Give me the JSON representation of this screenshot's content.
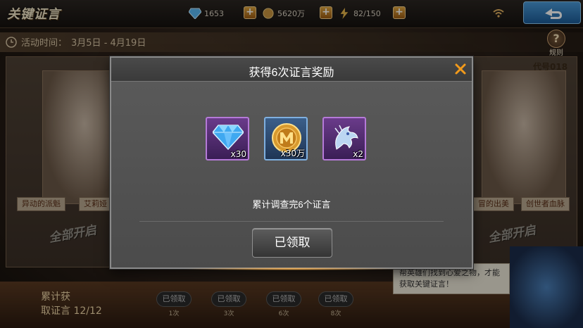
{
  "game": {
    "title": "关键证言"
  },
  "resources": {
    "diamonds": "1653",
    "coins": "5620万",
    "energy": "82/150"
  },
  "activity": {
    "label": "活动时间：",
    "period": "3月5日 - 4月19日"
  },
  "rules": {
    "label": "规则",
    "icon": "question-icon"
  },
  "codename": "代号018",
  "heroes": {
    "name_tags": [
      "异动的派魁",
      "艾莉娅",
      "冒的出美",
      "创世者血脉"
    ],
    "stamp_text": "全部开启"
  },
  "modal": {
    "title": "获得6次证言奖励",
    "rewards": [
      {
        "icon": "diamond-icon",
        "quantity": "x30"
      },
      {
        "icon": "gold-coin-icon",
        "quantity": "x30万"
      },
      {
        "icon": "ice-dragon-icon",
        "quantity": "x2"
      }
    ],
    "description": "累计调查完6个证言",
    "claimed_button": "已领取",
    "accent": "#f29a1b"
  },
  "bottom": {
    "accum_label": "累计获",
    "accum_value": "取证言 12/12",
    "slots": [
      {
        "label": "已领取",
        "count": "1次"
      },
      {
        "label": "已领取",
        "count": "3次"
      },
      {
        "label": "已领取",
        "count": "6次"
      },
      {
        "label": "已领取",
        "count": "8次"
      }
    ]
  },
  "hint": {
    "text": "帮英雄们找到心爱之物，才能获取关键证言！"
  }
}
